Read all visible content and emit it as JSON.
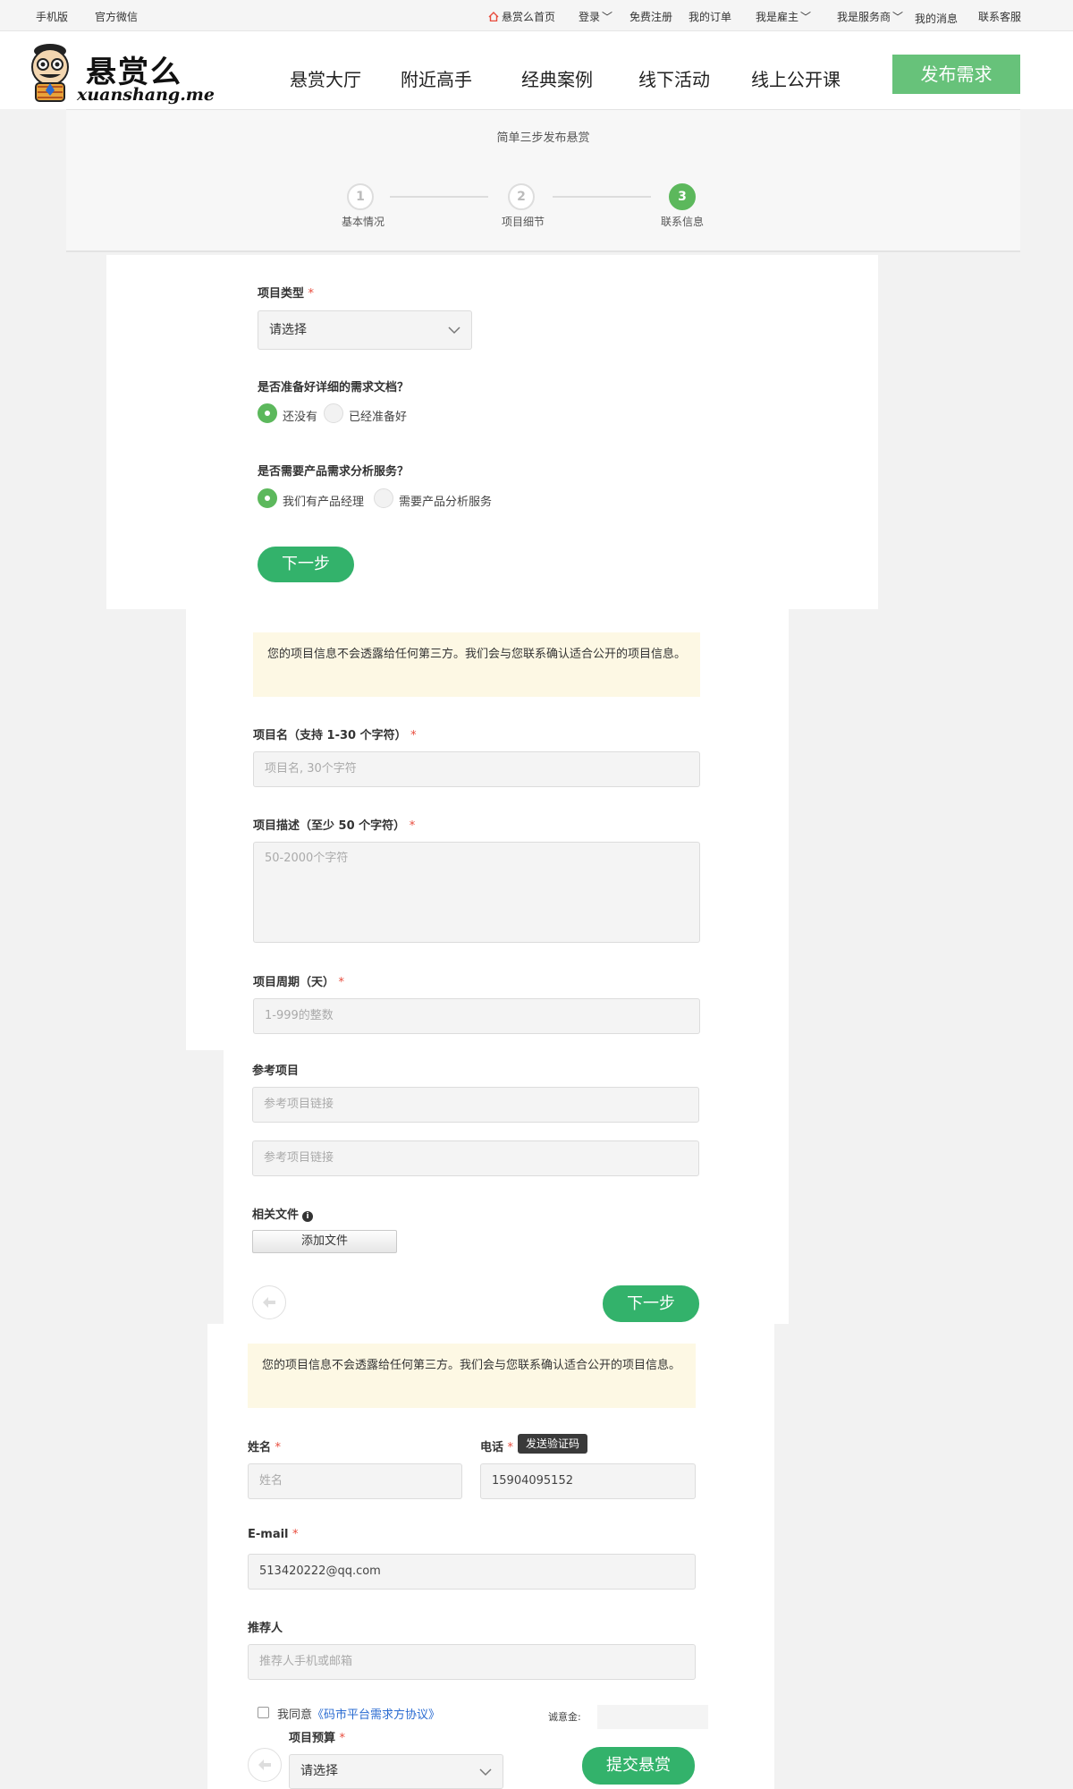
{
  "topbar": {
    "mobile": "手机版",
    "wechat": "官方微信",
    "home": "悬赏么首页",
    "login": "登录",
    "register": "免费注册",
    "orders": "我的订单",
    "employer": "我是雇主",
    "provider": "我是服务商",
    "messages": "我的消息",
    "support": "联系客服"
  },
  "header": {
    "logo_cn": "悬赏么",
    "logo_en": "xuanshang.me",
    "nav": [
      "悬赏大厅",
      "附近高手",
      "经典案例",
      "线下活动",
      "线上公开课"
    ],
    "publish": "发布需求"
  },
  "steps": {
    "title": "简单三步发布悬赏",
    "items": [
      {
        "num": "1",
        "label": "基本情况"
      },
      {
        "num": "2",
        "label": "项目细节"
      },
      {
        "num": "3",
        "label": "联系信息"
      }
    ]
  },
  "step1": {
    "type_label": "项目类型",
    "req": "*",
    "type_value": "请选择",
    "doc_question": "是否准备好详细的需求文档？",
    "doc_opt1": "还没有",
    "doc_opt2": "已经准备好",
    "pm_question": "是否需要产品需求分析服务？",
    "pm_opt1": "我们有产品经理",
    "pm_opt2": "需要产品分析服务",
    "next": "下一步"
  },
  "step2": {
    "notice": "您的项目信息不会透露给任何第三方。我们会与您联系确认适合公开的项目信息。",
    "name_label": "项目名（支持 1-30 个字符）",
    "name_placeholder": "项目名, 30个字符",
    "desc_label": "项目描述（至少 50 个字符）",
    "desc_placeholder": "50-2000个字符",
    "period_label": "项目周期（天）",
    "period_placeholder": "1-999的整数",
    "ref_label": "参考项目",
    "ref_placeholder_1": "参考项目链接",
    "ref_placeholder_2": "参考项目链接",
    "files_label": "相关文件",
    "add_file": "添加文件",
    "next": "下一步"
  },
  "step3": {
    "notice": "您的项目信息不会透露给任何第三方。我们会与您联系确认适合公开的项目信息。",
    "name_label": "姓名",
    "name_placeholder": "姓名",
    "phone_label": "电话",
    "send_code": "发送验证码",
    "phone_value": "15904095152",
    "email_label": "E-mail",
    "email_value": "513420222@qq.com",
    "referrer_label": "推荐人",
    "referrer_placeholder": "推荐人手机或邮箱",
    "agree_prefix": "我同意",
    "agree_link": "《码市平台需求方协议》",
    "deposit_label": "诚意金:",
    "budget_label": "项目预算",
    "budget_value": "请选择",
    "submit": "提交悬赏"
  },
  "colors": {
    "green": "#33b26b",
    "step_green": "#5cb85c",
    "publish_green": "#67c27a",
    "notice_bg": "#fdf8e4"
  }
}
